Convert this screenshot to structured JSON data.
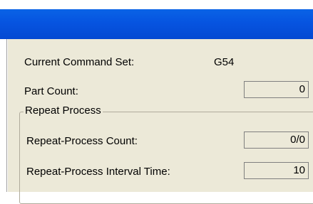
{
  "window": {
    "title": ""
  },
  "info": {
    "command_set_label": "Current Command Set:",
    "command_set_value": "G54",
    "part_count_label": "Part Count:",
    "part_count_value": "0"
  },
  "repeat": {
    "group_title": "Repeat Process",
    "count_label": "Repeat-Process Count:",
    "count_value": "0/0",
    "interval_label": "Repeat-Process Interval Time:",
    "interval_value": "10"
  },
  "colors": {
    "titlebar": "#0654e0",
    "panel": "#ece9d8"
  }
}
